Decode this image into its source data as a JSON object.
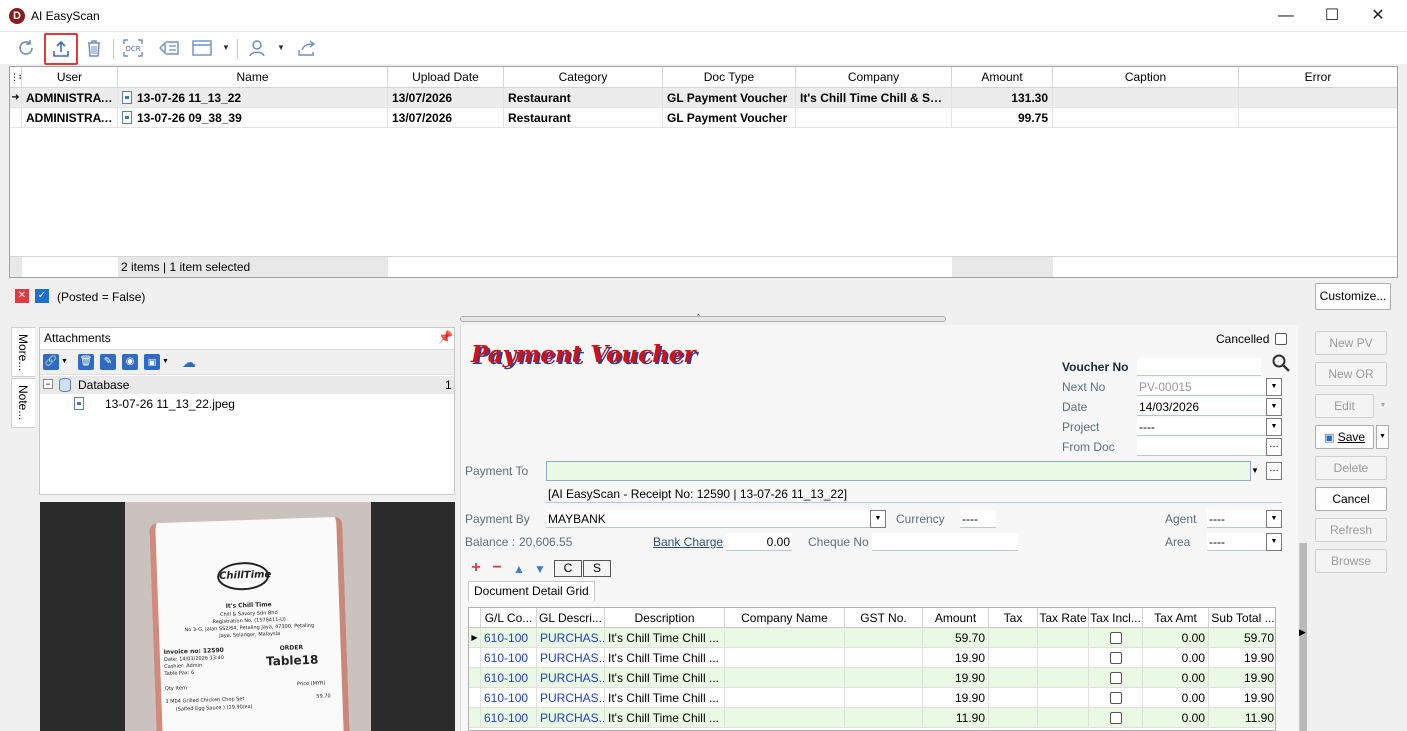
{
  "window": {
    "title": "AI EasyScan",
    "logo_letter": "D"
  },
  "grid": {
    "columns": [
      "User",
      "Name",
      "Upload Date",
      "Category",
      "Doc Type",
      "Company",
      "Amount",
      "Caption",
      "Error"
    ],
    "rows": [
      {
        "user": "ADMINISTRAT...",
        "name": "13-07-26 11_13_22",
        "upload_date": "13/07/2026",
        "category": "Restaurant",
        "doc_type": "GL Payment Voucher",
        "company": "It's Chill Time Chill & Sav...",
        "amount": "131.30",
        "caption": "",
        "error": ""
      },
      {
        "user": "ADMINISTRAT...",
        "name": "13-07-26 09_38_39",
        "upload_date": "13/07/2026",
        "category": "Restaurant",
        "doc_type": "GL Payment Voucher",
        "company": "",
        "amount": "99.75",
        "caption": "",
        "error": ""
      }
    ],
    "footer": "2 items |  1 item selected"
  },
  "filter": {
    "text": "(Posted = False)",
    "customize_label": "Customize..."
  },
  "side_tabs": [
    "More...",
    "Note..."
  ],
  "attachments": {
    "title": "Attachments",
    "tree_root": "Database",
    "tree_count": "1",
    "file": "13-07-26 11_13_22.jpeg"
  },
  "receipt": {
    "brand": "ChillTime",
    "shop": "It's Chill Time",
    "company": "Chill & Savory Sdn Bhd",
    "reg": "Registration No. (1578411-U)",
    "addr1": "No 3-G, Jalan SS2/64, Petaling Jaya, 47300, Petaling",
    "addr2": "Jaya, Selangor, Malaysia",
    "invoice": "Invoice no: 12590",
    "order": "ORDER",
    "date": "Date: 14/03/2026 13:40",
    "cashier": "Cashier: Admin",
    "table_pax": "Table Pax: 6",
    "table": "Table18",
    "qty": "Qty  Item",
    "price": "Price (MYR)",
    "item": "3    M04 Grilled Chicken Chop Set",
    "item_price": "59.70",
    "item_note": "(Salted Egg Sauce ) (19.90/ea)"
  },
  "voucher": {
    "heading": "Payment Voucher",
    "cancelled_label": "Cancelled",
    "voucher_no_label": "Voucher No",
    "voucher_no": "",
    "next_no_label": "Next No",
    "next_no": "PV-00015",
    "date_label": "Date",
    "date": "14/03/2026",
    "project_label": "Project",
    "project": "----",
    "from_doc_label": "From Doc",
    "from_doc": "",
    "payment_to_label": "Payment To",
    "payment_to": "",
    "description": "[AI EasyScan - Receipt No: 12590 | 13-07-26 11_13_22]",
    "payment_by_label": "Payment By",
    "payment_by": "MAYBANK",
    "currency_label": "Currency",
    "currency": "----",
    "agent_label": "Agent",
    "agent": "----",
    "balance_label": "Balance :",
    "balance": "20,606.55",
    "bank_charge_label": "Bank Charge",
    "bank_charge": "0.00",
    "cheque_no_label": "Cheque No",
    "cheque_no": "",
    "area_label": "Area",
    "area": "----",
    "btn_c": "C",
    "btn_s": "S",
    "detail_tab": "Document Detail Grid"
  },
  "detail": {
    "columns": [
      "G/L Co...",
      "GL Descri...",
      "Description",
      "Company Name",
      "GST No.",
      "Amount",
      "Tax",
      "Tax Rate",
      "Tax Incl...",
      "Tax Amt",
      "Sub Total ..."
    ],
    "rows": [
      {
        "gl": "610-100",
        "gl_desc": "PURCHAS...",
        "desc": "It's Chill Time Chill ...",
        "amount": "59.70",
        "tax_amt": "0.00",
        "sub_total": "59.70"
      },
      {
        "gl": "610-100",
        "gl_desc": "PURCHAS...",
        "desc": "It's Chill Time Chill ...",
        "amount": "19.90",
        "tax_amt": "0.00",
        "sub_total": "19.90"
      },
      {
        "gl": "610-100",
        "gl_desc": "PURCHAS...",
        "desc": "It's Chill Time Chill ...",
        "amount": "19.90",
        "tax_amt": "0.00",
        "sub_total": "19.90"
      },
      {
        "gl": "610-100",
        "gl_desc": "PURCHAS...",
        "desc": "It's Chill Time Chill ...",
        "amount": "19.90",
        "tax_amt": "0.00",
        "sub_total": "19.90"
      },
      {
        "gl": "610-100",
        "gl_desc": "PURCHAS...",
        "desc": "It's Chill Time Chill ...",
        "amount": "11.90",
        "tax_amt": "0.00",
        "sub_total": "11.90"
      }
    ]
  },
  "actions": {
    "new_pv": "New PV",
    "new_or": "New OR",
    "edit": "Edit",
    "save": "Save",
    "delete": "Delete",
    "cancel": "Cancel",
    "refresh": "Refresh",
    "browse": "Browse"
  },
  "colors": {
    "accent": "#1e6fd0",
    "highlight": "#e0393e",
    "heading_red": "#d41111",
    "green_row": "#e9f9e3"
  }
}
